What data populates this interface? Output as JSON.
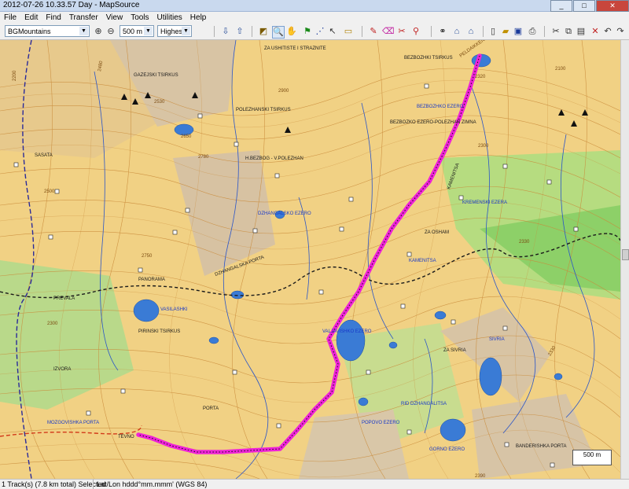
{
  "window": {
    "title": "2012-07-26 10.33.57 Day - MapSource"
  },
  "menu": [
    "File",
    "Edit",
    "Find",
    "Transfer",
    "View",
    "Tools",
    "Utilities",
    "Help"
  ],
  "toolbar": {
    "product": "BGMountains",
    "zoom": "500 m",
    "detail": "Highest"
  },
  "status": {
    "selection": "1 Track(s) (7.8 km total) Selected",
    "position_format": "Lat/Lon hddd°mm.mmm' (WGS 84)"
  },
  "scale": "500 m",
  "map": {
    "spot_heights": [
      "2320",
      "2100",
      "2530",
      "2650",
      "2780",
      "2300",
      "2500",
      "2300",
      "2330",
      "2390"
    ],
    "peaks": [
      "PELDAIKKEN",
      "2200",
      "2480",
      "2900",
      "2750",
      "2330"
    ],
    "place_labels": [
      "ZA USHITISTE I STRAZNITE",
      "BEZBOZHKI TSIRKUS",
      "POLEZHANSKI TSIRKUS",
      "GAZEJSKI TSIRKUS",
      "SASATA",
      "BEZBOZKO EZERO-POLEZHAN ZIMNA",
      "H.BEZBOG - V.POLEZHAN",
      "DZHANGALSKA PORTA",
      "ZA OSHAM",
      "KAMENITSA",
      "PANORAMA",
      "PREVALA",
      "PIRINSKI TSIRKUS",
      "ZA SIVRIA",
      "IZVORA",
      "PORTA",
      "TEVNO",
      "BANDERISHKA PORTA"
    ],
    "blue_labels": [
      "BEZBOZHKO EZERO",
      "DZHANGALSKO EZERO",
      "VALJAVISHKO EZERO",
      "KREMENSKI EZERA",
      "SIVRIA",
      "POPOVO EZERO",
      "KAMENITSA",
      "VASILASHKI",
      "RID DZHANGALITSA",
      "MOZGOVISHKA PORTA",
      "GORNO EZERO"
    ]
  }
}
